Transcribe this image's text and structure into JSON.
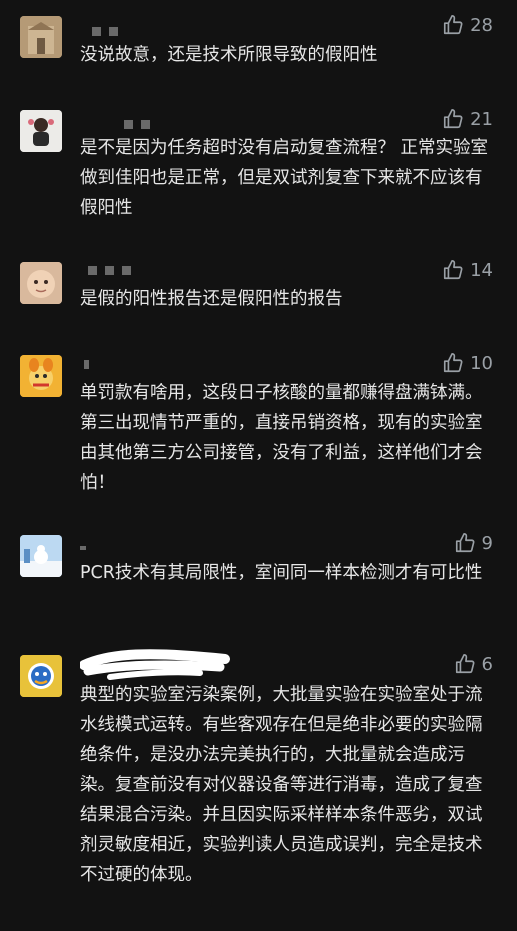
{
  "comments": [
    {
      "likes": "28",
      "text": "没说故意，还是技术所限导致的假阳性",
      "avatar_color": "#b59a76"
    },
    {
      "likes": "21",
      "text": "是不是因为任务超时没有启动复查流程？ 正常实验室做到佳阳也是正常，但是双试剂复查下来就不应该有假阳性",
      "avatar_color": "#e9e5e0"
    },
    {
      "likes": "14",
      "text": "是假的阳性报告还是假阳性的报告",
      "avatar_color": "#d9b99d"
    },
    {
      "likes": "10",
      "text": "单罚款有啥用，这段日子核酸的量都赚得盘满钵满。第三出现情节严重的，直接吊销资格，现有的实验室由其他第三方公司接管，没有了利益，这样他们才会怕！",
      "avatar_color": "#f2b233"
    },
    {
      "likes": "9",
      "text": "PCR技术有其局限性，室间同一样本检测才有可比性",
      "avatar_color": "#9ec6ea"
    },
    {
      "likes": "6",
      "text": "典型的实验室污染案例，大批量实验在实验室处于流水线模式运转。有些客观存在但是绝非必要的实验隔绝条件，是没办法完美执行的，大批量就会造成污染。复查前没有对仪器设备等进行消毒，造成了复查结果混合污染。并且因实际采样样本条件恶劣，双试剂灵敏度相近，实验判读人员造成误判，完全是技术不过硬的体现。",
      "avatar_color": "#e8c23a"
    }
  ]
}
